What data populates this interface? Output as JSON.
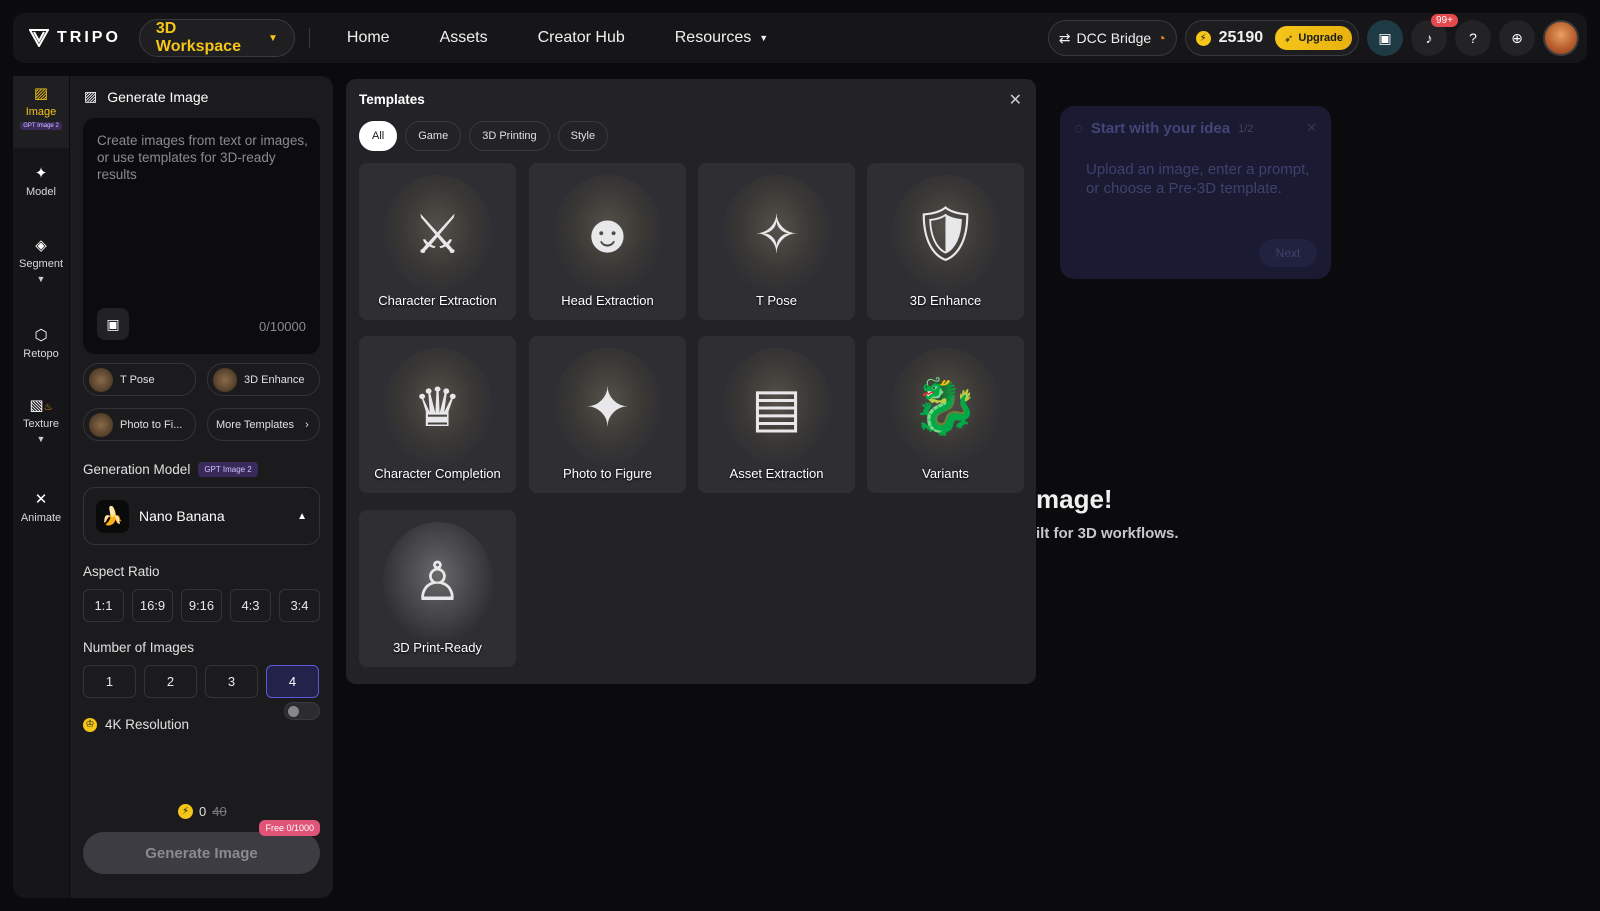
{
  "header": {
    "logo_text": "TRIPO",
    "workspace_label": "3D Workspace",
    "nav": [
      {
        "label": "Home"
      },
      {
        "label": "Assets"
      },
      {
        "label": "Creator Hub"
      },
      {
        "label": "Resources"
      }
    ],
    "dcc_bridge_label": "DCC Bridge",
    "credits": "25190",
    "upgrade_label": "Upgrade",
    "notifications_badge": "99+"
  },
  "rail": {
    "items": [
      {
        "label": "Image",
        "badge": "GPT Image 2"
      },
      {
        "label": "Model"
      },
      {
        "label": "Segment"
      },
      {
        "label": "Retopo"
      },
      {
        "label": "Texture"
      },
      {
        "label": "Animate"
      }
    ]
  },
  "panel": {
    "title": "Generate Image",
    "prompt_placeholder": "Create images from text or images, or use templates for 3D-ready results",
    "counter": "0/10000",
    "quick_templates": [
      {
        "label": "T Pose"
      },
      {
        "label": "3D Enhance"
      },
      {
        "label": "Photo to Fi..."
      },
      {
        "label": "More Templates"
      }
    ],
    "generation_model_label": "Generation Model",
    "generation_model_tag": "GPT Image 2",
    "model_name": "Nano Banana",
    "aspect_ratio_label": "Aspect Ratio",
    "aspect_ratios": [
      "1:1",
      "16:9",
      "9:16",
      "4:3",
      "3:4"
    ],
    "num_images_label": "Number of Images",
    "num_images": [
      "1",
      "2",
      "3",
      "4"
    ],
    "num_images_selected": "4",
    "resolution_label": "4K Resolution",
    "resolution_enabled": false,
    "cost_value": "0",
    "cost_original": "40",
    "free_tag": "Free 0/1000",
    "generate_label": "Generate Image"
  },
  "templates": {
    "title": "Templates",
    "tabs": [
      "All",
      "Game",
      "3D Printing",
      "Style"
    ],
    "active_tab": "All",
    "cards": [
      {
        "label": "Character Extraction",
        "icon": "⚔"
      },
      {
        "label": "Head Extraction",
        "icon": "☻"
      },
      {
        "label": "T Pose",
        "icon": "✧"
      },
      {
        "label": "3D Enhance",
        "icon": "🛡"
      },
      {
        "label": "Character Completion",
        "icon": "♛"
      },
      {
        "label": "Photo to Figure",
        "icon": "✦"
      },
      {
        "label": "Asset Extraction",
        "icon": "▤"
      },
      {
        "label": "Variants",
        "icon": "🐉"
      },
      {
        "label": "3D Print-Ready",
        "icon": "♙"
      }
    ]
  },
  "hint": {
    "title": "Start with your idea",
    "step": "1/2",
    "body": "Upload an image, enter a prompt, or choose a Pre-3D template.",
    "next_label": "Next"
  },
  "background": {
    "heading_fragment": "mage!",
    "sub_fragment": "ilt for 3D workflows."
  },
  "colors": {
    "accent": "#f5c518",
    "selected_border": "#5a5ad8",
    "free_tag": "#e05577"
  }
}
